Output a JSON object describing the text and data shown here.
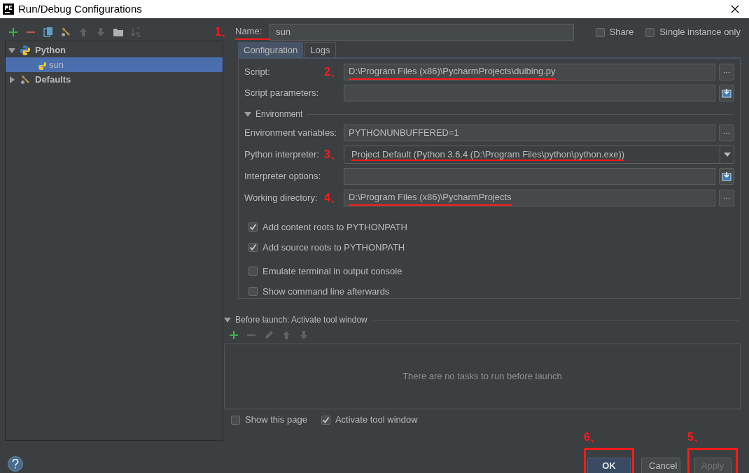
{
  "window": {
    "title": "Run/Debug Configurations"
  },
  "toolbar": [
    {
      "kind": "add",
      "disabled": false
    },
    {
      "kind": "remove",
      "disabled": false
    },
    {
      "kind": "copy",
      "disabled": false
    },
    {
      "kind": "wrench",
      "disabled": false
    },
    {
      "kind": "up",
      "disabled": true
    },
    {
      "kind": "down",
      "disabled": true
    },
    {
      "kind": "folder",
      "disabled": false
    },
    {
      "kind": "sort",
      "disabled": true
    }
  ],
  "tree": [
    {
      "label": "Python",
      "kind": "python",
      "expanded": true,
      "selected": false,
      "children": [
        {
          "label": "sun",
          "kind": "python",
          "selected": true
        }
      ]
    },
    {
      "label": "Defaults",
      "kind": "wrench",
      "expanded": false,
      "selected": false
    }
  ],
  "name_field": {
    "label": "Name:",
    "value": "sun",
    "annotation": "1、"
  },
  "options": [
    {
      "label": "Share",
      "checked": false
    },
    {
      "label": "Single instance only",
      "checked": false
    }
  ],
  "tabs": [
    {
      "label": "Configuration",
      "selected": true
    },
    {
      "label": "Logs",
      "selected": false
    }
  ],
  "fields": [
    {
      "label": "Script:",
      "value": "D:\\Program Files (x86)\\PycharmProjects\\duibing.py",
      "kind": "browse",
      "annotation": "2、"
    },
    {
      "label": "Script parameters:",
      "kind": "expand"
    }
  ],
  "environment": {
    "title": "Environment",
    "expanded": true,
    "fields": [
      {
        "label": "Environment variables:",
        "value": "PYTHONUNBUFFERED=1",
        "kind": "browse"
      },
      {
        "label": "Python interpreter:",
        "value": "Project Default (Python 3.6.4 (D:\\Program Files\\python\\python.exe))",
        "kind": "dropdown",
        "annotation": "3、"
      },
      {
        "label": "Interpreter options:",
        "kind": "expand"
      },
      {
        "label": "Working directory:",
        "value": "D:\\Program Files (x86)\\PycharmProjects",
        "kind": "browse",
        "annotation": "4、"
      }
    ],
    "checkboxes": [
      {
        "label": "Add content roots to PYTHONPATH",
        "checked": true
      },
      {
        "label": "Add source roots to PYTHONPATH",
        "checked": true
      },
      {
        "label": "Emulate terminal in output console",
        "checked": false
      },
      {
        "label": "Show command line afterwards",
        "checked": false
      }
    ]
  },
  "before_launch": {
    "title": "Before launch: Activate tool window",
    "expanded": true,
    "toolbar": [
      {
        "kind": "add",
        "disabled": false
      },
      {
        "kind": "remove",
        "disabled": true
      },
      {
        "kind": "edit",
        "disabled": true
      },
      {
        "kind": "up",
        "disabled": true
      },
      {
        "kind": "down",
        "disabled": true
      }
    ],
    "empty_text": "There are no tasks to run before launch"
  },
  "bottom_options": [
    {
      "label": "Show this page",
      "checked": false
    },
    {
      "label": "Activate tool window",
      "checked": true
    }
  ],
  "buttons": [
    {
      "label": "OK",
      "kind": "default",
      "disabled": false,
      "annotation": "6、",
      "highlighted": true
    },
    {
      "label": "Cancel",
      "kind": "normal",
      "disabled": false,
      "highlighted": false
    },
    {
      "label": "Apply",
      "kind": "normal",
      "disabled": true,
      "annotation": "5、",
      "highlighted": true
    }
  ]
}
